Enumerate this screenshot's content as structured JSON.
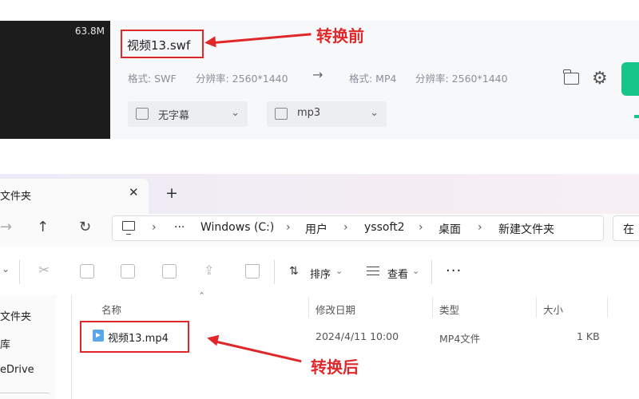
{
  "converter": {
    "thumbnail_size": "63.8M",
    "source_name": "视频13.swf",
    "source_format": "格式: SWF",
    "source_resolution": "分辨率: 2560*1440",
    "target_format": "格式: MP4",
    "target_resolution": "分辨率: 2560*1440",
    "subtitle_value": "无字幕",
    "audio_value": "mp3",
    "annotation_before": "转换前",
    "accent_color": "#17c48a"
  },
  "explorer": {
    "tab_title": "文件夹",
    "breadcrumbs": [
      "Windows (C:)",
      "用户",
      "yssoft2",
      "桌面",
      "新建文件夹"
    ],
    "more_breadcrumbs": "···",
    "search_text": "在",
    "toolbar": {
      "sort_label": "排序",
      "view_label": "查看",
      "more_label": "···"
    },
    "nav_items": [
      "文件夹",
      "库",
      "eDrive"
    ],
    "columns": [
      "名称",
      "修改日期",
      "类型",
      "大小"
    ],
    "files": [
      {
        "name": "视频13.mp4",
        "modified": "2024/4/11 10:00",
        "type": "MP4文件",
        "size": "1 KB"
      }
    ],
    "annotation_after": "转换后"
  },
  "colors": {
    "annotation_red": "#e0282b"
  }
}
